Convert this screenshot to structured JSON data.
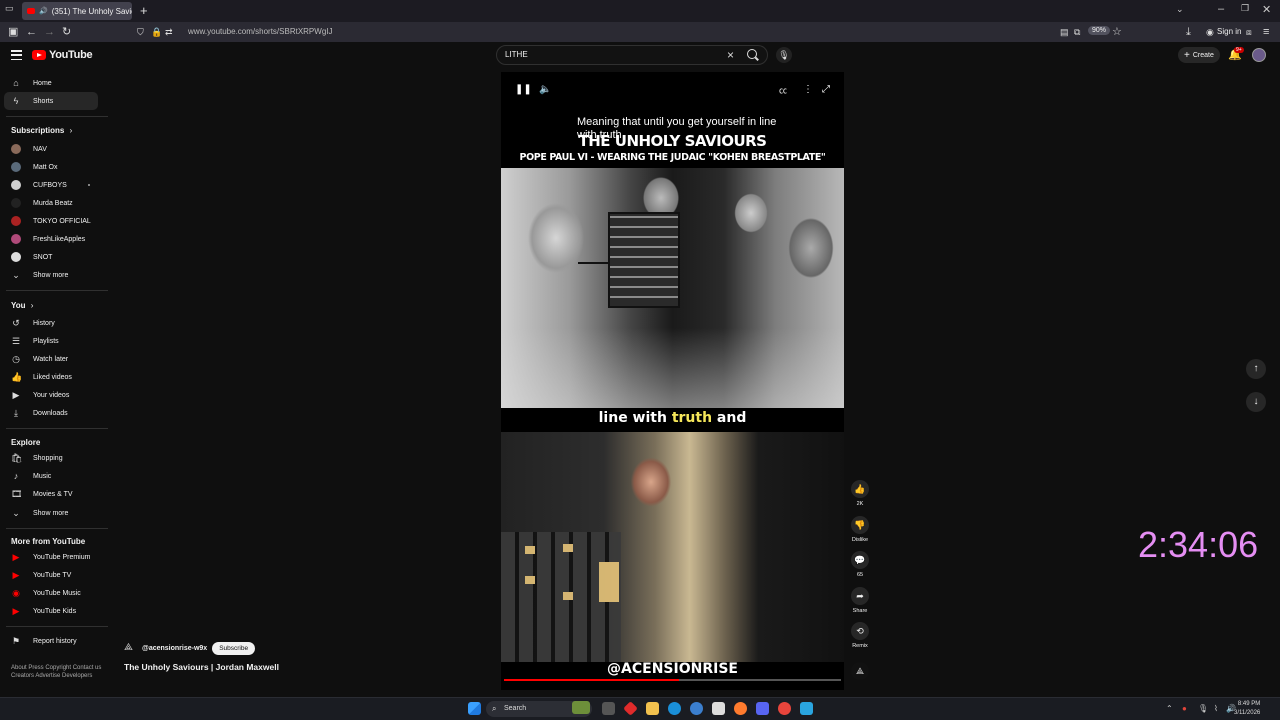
{
  "browser": {
    "tab_title": "(351) The Unholy Saviours",
    "new_tab": "+",
    "url": "www.youtube.com/shorts/SBRtXRPWgIJ",
    "zoom": "90%",
    "sign_in": "Sign in"
  },
  "youtube": {
    "logo_text": "YouTube",
    "search": {
      "value": "LITHE"
    },
    "create_label": "Create",
    "notification_count": "9+"
  },
  "sidebar": {
    "main": [
      {
        "label": "Home",
        "icon": "home-icon"
      },
      {
        "label": "Shorts",
        "icon": "shorts-icon",
        "active": true
      }
    ],
    "subscriptions_heading": "Subscriptions",
    "subscriptions": [
      {
        "label": "NAV",
        "color": "#8a6a5a"
      },
      {
        "label": "Matt Ox",
        "color": "#5a6a7a"
      },
      {
        "label": "CUFBOYS",
        "color": "#cfcfcf",
        "new": true
      },
      {
        "label": "Murda Beatz",
        "color": "#222222"
      },
      {
        "label": "TOKYO OFFICIAL",
        "color": "#aa2222"
      },
      {
        "label": "FreshLikeApples",
        "color": "#b04a7a"
      },
      {
        "label": "SNOT",
        "color": "#dddddd"
      }
    ],
    "show_more": "Show more",
    "you_heading": "You",
    "you": [
      {
        "label": "History",
        "icon": "history-icon"
      },
      {
        "label": "Playlists",
        "icon": "playlists-icon"
      },
      {
        "label": "Watch later",
        "icon": "watch-later-icon"
      },
      {
        "label": "Liked videos",
        "icon": "like-icon"
      },
      {
        "label": "Your videos",
        "icon": "your-videos-icon"
      },
      {
        "label": "Downloads",
        "icon": "download-icon"
      }
    ],
    "explore_heading": "Explore",
    "explore": [
      {
        "label": "Shopping",
        "icon": "shopping-icon"
      },
      {
        "label": "Music",
        "icon": "music-icon"
      },
      {
        "label": "Movies & TV",
        "icon": "movies-icon"
      },
      {
        "label": "Show more",
        "icon": "chevron-down-icon"
      }
    ],
    "more_heading": "More from YouTube",
    "more": [
      {
        "label": "YouTube Premium"
      },
      {
        "label": "YouTube TV"
      },
      {
        "label": "YouTube Music"
      },
      {
        "label": "YouTube Kids"
      }
    ],
    "report_history": "Report history",
    "footer": "About  Press  Copyright  Contact us  Creators  Advertise  Developers"
  },
  "short": {
    "overlay_caption": "Meaning that until you get yourself in line with truth",
    "photo_title": "THE UNHOLY SAVIOURS",
    "photo_subtitle": "POPE PAUL VI - WEARING THE JUDAIC \"KOHEN BREASTPLATE\"",
    "caption_pre": "line with ",
    "caption_highlight": "truth",
    "caption_post": " and",
    "watermark": "@ACENSIONRISE",
    "progress": 0.52,
    "channel": "@acensionrise-w9x",
    "subscribe": "Subscribe",
    "title": "The Unholy Saviours | Jordan Maxwell"
  },
  "actions": {
    "like_count": "2K",
    "dislike": "Dislike",
    "comment_count": "65",
    "share": "Share",
    "remix": "Remix"
  },
  "overlay_timer": "2:34:06",
  "taskbar": {
    "search": "Search",
    "time": "8:49 PM",
    "date": "3/11/2026"
  }
}
